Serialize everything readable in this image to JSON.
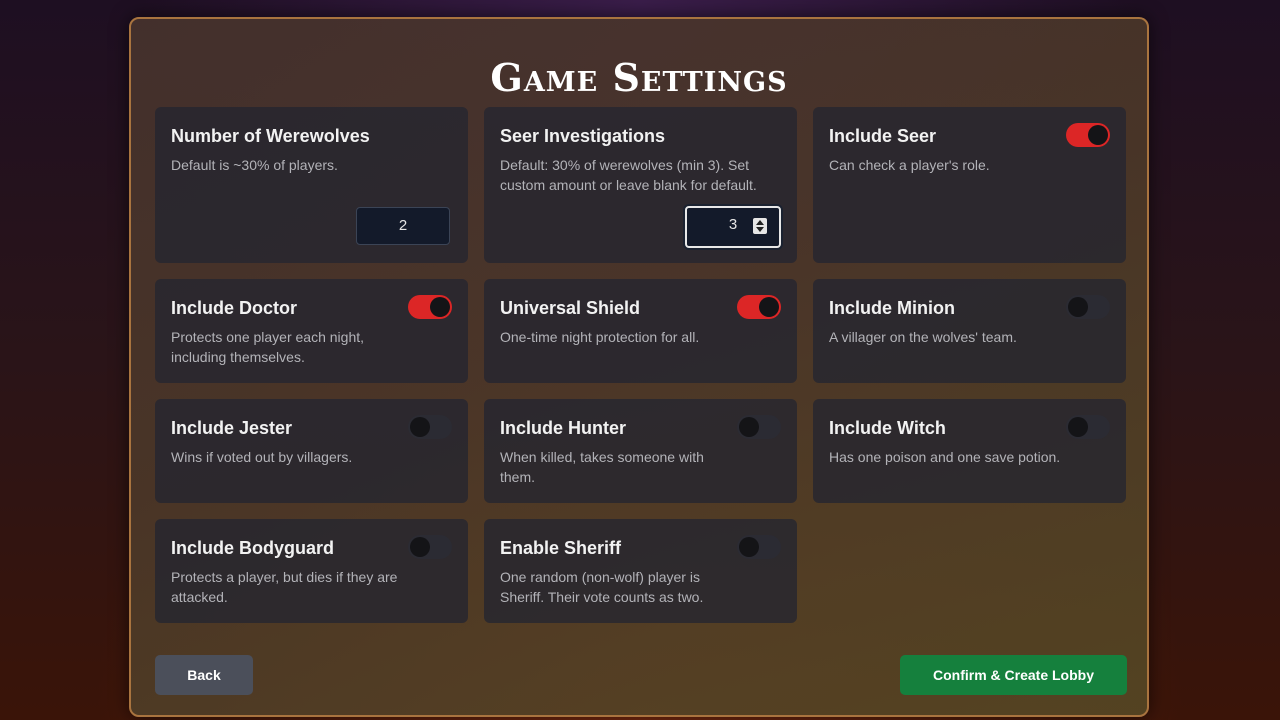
{
  "title": "Game Settings",
  "cards": {
    "werewolves": {
      "title": "Number of Werewolves",
      "desc": "Default is ~30% of players.",
      "value": "2"
    },
    "seer_investigations": {
      "title": "Seer Investigations",
      "desc": "Default: 30% of werewolves (min 3). Set custom amount or leave blank for default.",
      "value": "3"
    },
    "seer": {
      "title": "Include Seer",
      "desc": "Can check a player's role.",
      "enabled": true
    },
    "doctor": {
      "title": "Include Doctor",
      "desc": "Protects one player each night, including themselves.",
      "enabled": true
    },
    "shield": {
      "title": "Universal Shield",
      "desc": "One-time night protection for all.",
      "enabled": true
    },
    "minion": {
      "title": "Include Minion",
      "desc": "A villager on the wolves' team.",
      "enabled": false
    },
    "jester": {
      "title": "Include Jester",
      "desc": "Wins if voted out by villagers.",
      "enabled": false
    },
    "hunter": {
      "title": "Include Hunter",
      "desc": "When killed, takes someone with them.",
      "enabled": false
    },
    "witch": {
      "title": "Include Witch",
      "desc": "Has one poison and one save potion.",
      "enabled": false
    },
    "bodyguard": {
      "title": "Include Bodyguard",
      "desc": "Protects a player, but dies if they are attacked.",
      "enabled": false
    },
    "sheriff": {
      "title": "Enable Sheriff",
      "desc": "One random (non-wolf) player is Sheriff. Their vote counts as two.",
      "enabled": false
    }
  },
  "buttons": {
    "back": "Back",
    "confirm": "Confirm & Create Lobby"
  },
  "colors": {
    "toggle_on": "#dc2626",
    "confirm": "#15803d",
    "panel_border": "#a9743f"
  }
}
